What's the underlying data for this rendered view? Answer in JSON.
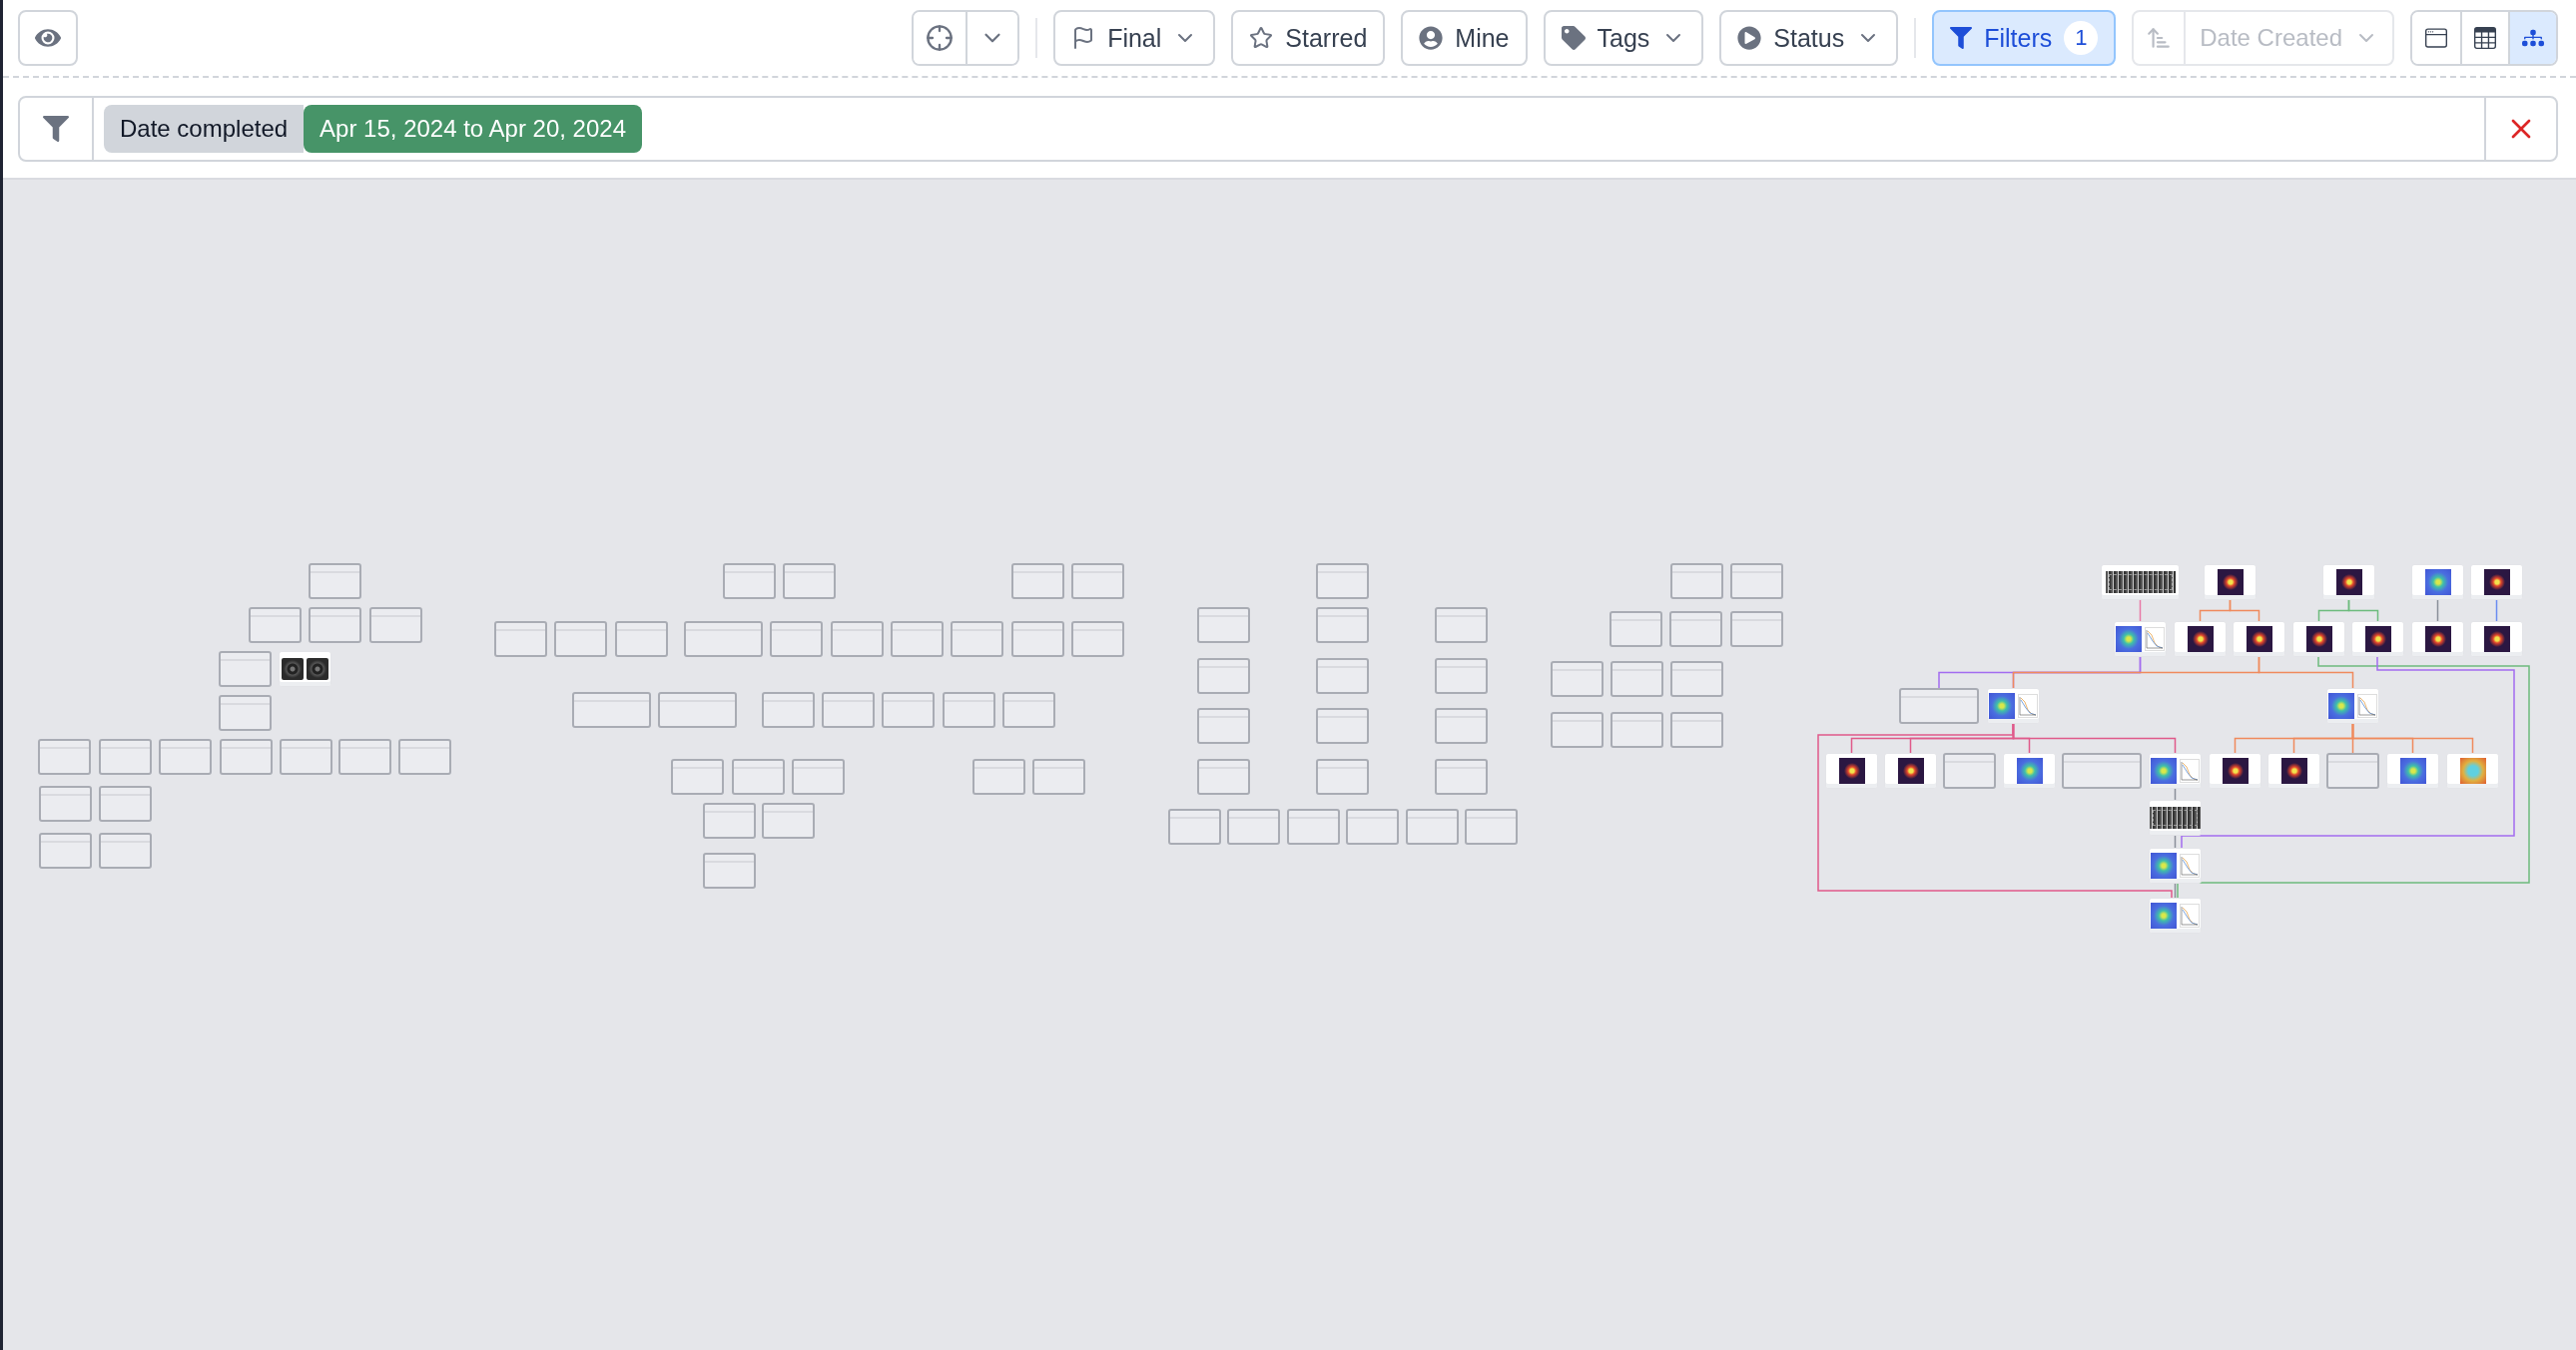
{
  "toolbar": {
    "dropdowns": [
      {
        "kind": "flag",
        "label": "Final",
        "has_menu": true
      },
      {
        "kind": "star",
        "label": "Starred",
        "has_menu": false
      },
      {
        "kind": "user",
        "label": "Mine",
        "has_menu": false
      },
      {
        "kind": "tag",
        "label": "Tags",
        "has_menu": true
      },
      {
        "kind": "status",
        "label": "Status",
        "has_menu": true
      }
    ],
    "filters_button": {
      "label": "Filters",
      "count": "1",
      "active": true
    },
    "sort": {
      "label": "Date Created",
      "disabled": true
    },
    "views": [
      {
        "kind": "card",
        "selected": false
      },
      {
        "kind": "table",
        "selected": false
      },
      {
        "kind": "tree",
        "selected": true
      }
    ]
  },
  "filter_bar": {
    "chips": [
      {
        "field": "Date completed",
        "value": "Apr 15, 2024 to Apr 20, 2024"
      }
    ]
  },
  "canvas": {
    "nodes": [
      {
        "kind": "empty"
      },
      {
        "kind": "empty"
      },
      {
        "kind": "empty"
      },
      {
        "kind": "empty"
      },
      {
        "kind": "empty"
      },
      {
        "kind": "pair"
      },
      {
        "kind": "empty"
      },
      {
        "kind": "empty"
      },
      {
        "kind": "empty"
      },
      {
        "kind": "empty"
      },
      {
        "kind": "empty"
      },
      {
        "kind": "empty"
      },
      {
        "kind": "empty"
      },
      {
        "kind": "empty"
      },
      {
        "kind": "empty"
      },
      {
        "kind": "empty"
      },
      {
        "kind": "empty"
      },
      {
        "kind": "empty"
      },
      {
        "kind": "empty"
      },
      {
        "kind": "empty"
      },
      {
        "kind": "empty"
      },
      {
        "kind": "empty"
      },
      {
        "kind": "empty"
      },
      {
        "kind": "empty"
      },
      {
        "kind": "empty"
      },
      {
        "kind": "empty"
      },
      {
        "kind": "empty"
      },
      {
        "kind": "empty"
      },
      {
        "kind": "empty"
      },
      {
        "kind": "empty"
      },
      {
        "kind": "empty"
      },
      {
        "kind": "empty"
      },
      {
        "kind": "empty"
      },
      {
        "kind": "empty"
      },
      {
        "kind": "empty"
      },
      {
        "kind": "empty"
      },
      {
        "kind": "empty"
      },
      {
        "kind": "empty"
      },
      {
        "kind": "empty"
      },
      {
        "kind": "empty"
      },
      {
        "kind": "empty"
      },
      {
        "kind": "empty"
      },
      {
        "kind": "empty"
      },
      {
        "kind": "empty"
      },
      {
        "kind": "empty"
      },
      {
        "kind": "empty"
      },
      {
        "kind": "empty"
      },
      {
        "kind": "empty"
      },
      {
        "kind": "empty"
      },
      {
        "kind": "empty"
      },
      {
        "kind": "empty"
      },
      {
        "kind": "empty"
      },
      {
        "kind": "empty"
      },
      {
        "kind": "empty"
      },
      {
        "kind": "empty"
      },
      {
        "kind": "empty"
      },
      {
        "kind": "empty"
      },
      {
        "kind": "empty"
      },
      {
        "kind": "empty"
      },
      {
        "kind": "empty"
      },
      {
        "kind": "empty"
      },
      {
        "kind": "empty"
      },
      {
        "kind": "empty"
      },
      {
        "kind": "empty"
      },
      {
        "kind": "empty"
      },
      {
        "kind": "empty"
      },
      {
        "kind": "empty"
      },
      {
        "kind": "empty"
      },
      {
        "kind": "empty"
      },
      {
        "kind": "empty"
      },
      {
        "kind": "empty"
      },
      {
        "kind": "empty"
      },
      {
        "kind": "empty"
      },
      {
        "kind": "empty"
      },
      {
        "kind": "empty"
      },
      {
        "kind": "empty"
      },
      {
        "kind": "empty"
      },
      {
        "kind": "grid"
      },
      {
        "kind": "dark"
      },
      {
        "kind": "dark"
      },
      {
        "kind": "blue"
      },
      {
        "kind": "dark"
      },
      {
        "kind": "bluechart"
      },
      {
        "kind": "dark"
      },
      {
        "kind": "dark"
      },
      {
        "kind": "dark"
      },
      {
        "kind": "dark"
      },
      {
        "kind": "dark"
      },
      {
        "kind": "dark"
      },
      {
        "kind": "empty"
      },
      {
        "kind": "bluechart"
      },
      {
        "kind": "bluechart"
      },
      {
        "kind": "dark"
      },
      {
        "kind": "dark"
      },
      {
        "kind": "empty"
      },
      {
        "kind": "blue"
      },
      {
        "kind": "empty"
      },
      {
        "kind": "bluechart"
      },
      {
        "kind": "dark"
      },
      {
        "kind": "dark"
      },
      {
        "kind": "empty"
      },
      {
        "kind": "blue"
      },
      {
        "kind": "colormap"
      },
      {
        "kind": "grid"
      },
      {
        "kind": "bluechart"
      },
      {
        "kind": "bluechart"
      }
    ]
  }
}
